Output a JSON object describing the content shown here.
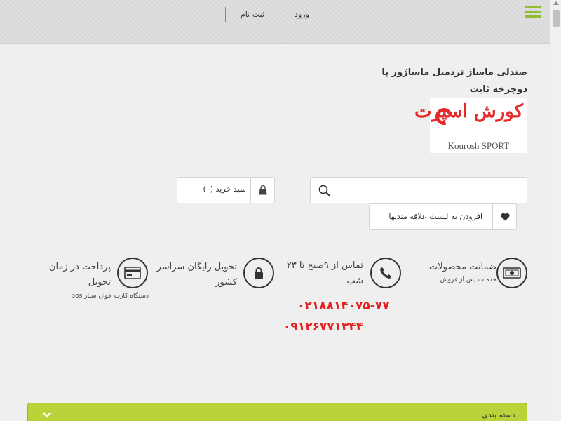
{
  "header": {
    "login_label": "ورود",
    "register_label": "ثبت نام"
  },
  "product": {
    "title_line1": "صندلی ماساژ تردمیل ماساژور پا",
    "title_line2": "دوچرخه ثابت"
  },
  "logo": {
    "text_fa": "کورش اسپرت",
    "text_en": "Kourosh SPORT"
  },
  "cart": {
    "label": "سبد خرید (۰)"
  },
  "search": {
    "placeholder": "",
    "value": ""
  },
  "wishlist": {
    "label": "افزودن به لیست علاقه مندیها"
  },
  "features": {
    "guarantee": {
      "title": "ضمانت محصولات",
      "subtitle": "خدمات پس از فروش"
    },
    "contact": {
      "title": "تماس از ۹صبح تا ۲۳ شب",
      "phone1": "۰۲۱۸۸۱۴۰۷۵-۷۷",
      "phone2": "۰۹۱۲۶۷۷۱۳۴۴"
    },
    "delivery": {
      "title": "تحویل رایگان سراسر کشور"
    },
    "payment": {
      "title": "پرداخت در زمان تحویل",
      "subtitle": "دستگاه کارت خوان سیار pos"
    }
  },
  "category": {
    "label": "دسته بندی"
  },
  "colors": {
    "accent_green": "#b9d43a",
    "hamburger_green": "#8fbf2f",
    "phone_red": "#e52020",
    "logo_red": "#e32b2b"
  },
  "icons": [
    "menu-icon",
    "cart-icon",
    "search-icon",
    "heart-icon",
    "money-icon",
    "phone-icon",
    "lock-icon",
    "credit-card-icon",
    "chevron-down-icon"
  ]
}
